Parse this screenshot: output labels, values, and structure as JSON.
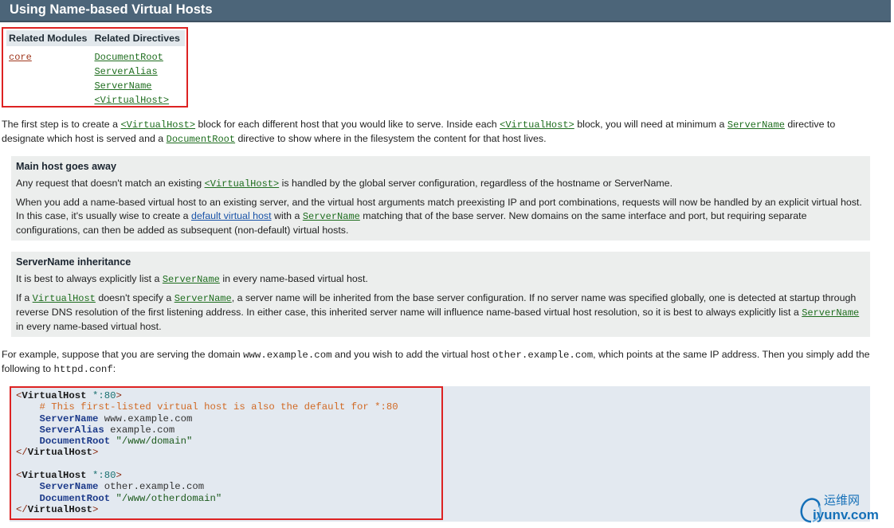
{
  "section_title": "Using Name-based Virtual Hosts",
  "related": {
    "modules_header": "Related Modules",
    "directives_header": "Related Directives",
    "modules": [
      "core"
    ],
    "directives": [
      "DocumentRoot",
      "ServerAlias",
      "ServerName",
      "<VirtualHost>"
    ]
  },
  "intro": {
    "p1": "The first step is to create a ",
    "virtualhost": "<VirtualHost>",
    "p2": " block for each different host that you would like to serve. Inside each ",
    "p3": " block, you will need at minimum a ",
    "servername": "ServerName",
    "p4": " directive to",
    "p5": "designate which host is served and a ",
    "documentroot": "DocumentRoot",
    "p6": " directive to show where in the filesystem the content for that host lives."
  },
  "note1": {
    "title": "Main host goes away",
    "a1": "Any request that doesn't match an existing ",
    "a_link": "<VirtualHost>",
    "a2": " is handled by the global server configuration, regardless of the hostname or ServerName.",
    "b1": "When you add a name-based virtual host to an existing server, and the virtual host arguments match preexisting IP and port combinations, requests will now be handled by an explicit virtual host. In this case, it's usually wise to create a ",
    "b_link1": "default virtual host",
    "b2": " with a ",
    "b_link2": "ServerName",
    "b3": " matching that of the base server. New domains on the same interface and port, but requiring separate configurations, can then be added as subsequent (non-default) virtual hosts."
  },
  "note2": {
    "title": "ServerName inheritance",
    "a1": "It is best to always explicitly list a ",
    "a_link": "ServerName",
    "a2": " in every name-based virtual host.",
    "b1": "If a ",
    "b_link1": "VirtualHost",
    "b2": " doesn't specify a ",
    "b_link2": "ServerName",
    "b3": ", a server name will be inherited from the base server configuration. If no server name was specified globally, one is detected at startup through reverse DNS resolution of the first listening address. In either case, this inherited server name will influence name-based virtual host resolution, so it is best to always explicitly list a ",
    "b_link3": "ServerName",
    "b4": " in every name-based virtual host."
  },
  "example": {
    "t1": "For example, suppose that you are serving the domain ",
    "domain": "www.example.com",
    "t2": " and you wish to add the virtual host ",
    "other": "other.example.com",
    "t3": ", which points at the same IP address. Then you simply add the",
    "t4": "following to ",
    "file": "httpd.conf",
    "t5": ":"
  },
  "code": {
    "lt": "<",
    "gt": ">",
    "lt_close": "</",
    "vh": "VirtualHost",
    "port": " *:80",
    "comment": "# This first-listed virtual host is also the default for *:80",
    "servername": "ServerName",
    "serveralias": "ServerAlias",
    "documentroot": "DocumentRoot",
    "host1": " www.example.com",
    "alias1": " example.com",
    "root1": " \"/www/domain\"",
    "host2": " other.example.com",
    "root2": " \"/www/otherdomain\""
  },
  "watermark": {
    "text": "运维网",
    "url": "iyunv.com"
  }
}
